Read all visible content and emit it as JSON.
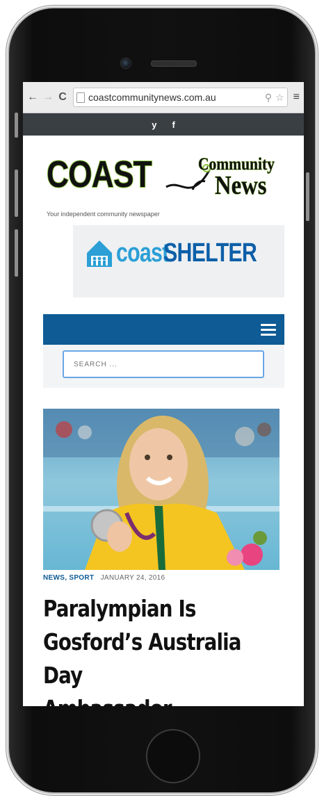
{
  "browser": {
    "url": "coastcommunitynews.com.au",
    "back_icon": "arrow-left",
    "forward_icon": "arrow-right",
    "reload_icon": "reload",
    "search_icon": "magnifier",
    "star_icon": "star",
    "menu_icon": "hamburger"
  },
  "social": {
    "twitter": "y",
    "facebook": "f"
  },
  "site": {
    "logo_main": "COAST",
    "logo_community": "Community",
    "logo_news": "News",
    "tagline": "Your independent community newspaper"
  },
  "ad": {
    "brand_part1": "coast",
    "brand_part2": "SHELTER"
  },
  "search": {
    "placeholder": "SEARCH ..."
  },
  "article": {
    "categories": "NEWS, SPORT",
    "date": "JANUARY 24, 2016",
    "title_line1": "Paralympian Is",
    "title_line2": "Gosford’s Australia Day",
    "title_line3": "Ambassador"
  },
  "colors": {
    "nav_blue": "#0e5b96",
    "logo_green": "#8cc63f",
    "ad_light_blue": "#2b9fd6",
    "ad_dark_blue": "#0d5fa8",
    "social_bar": "#3a3f44"
  }
}
